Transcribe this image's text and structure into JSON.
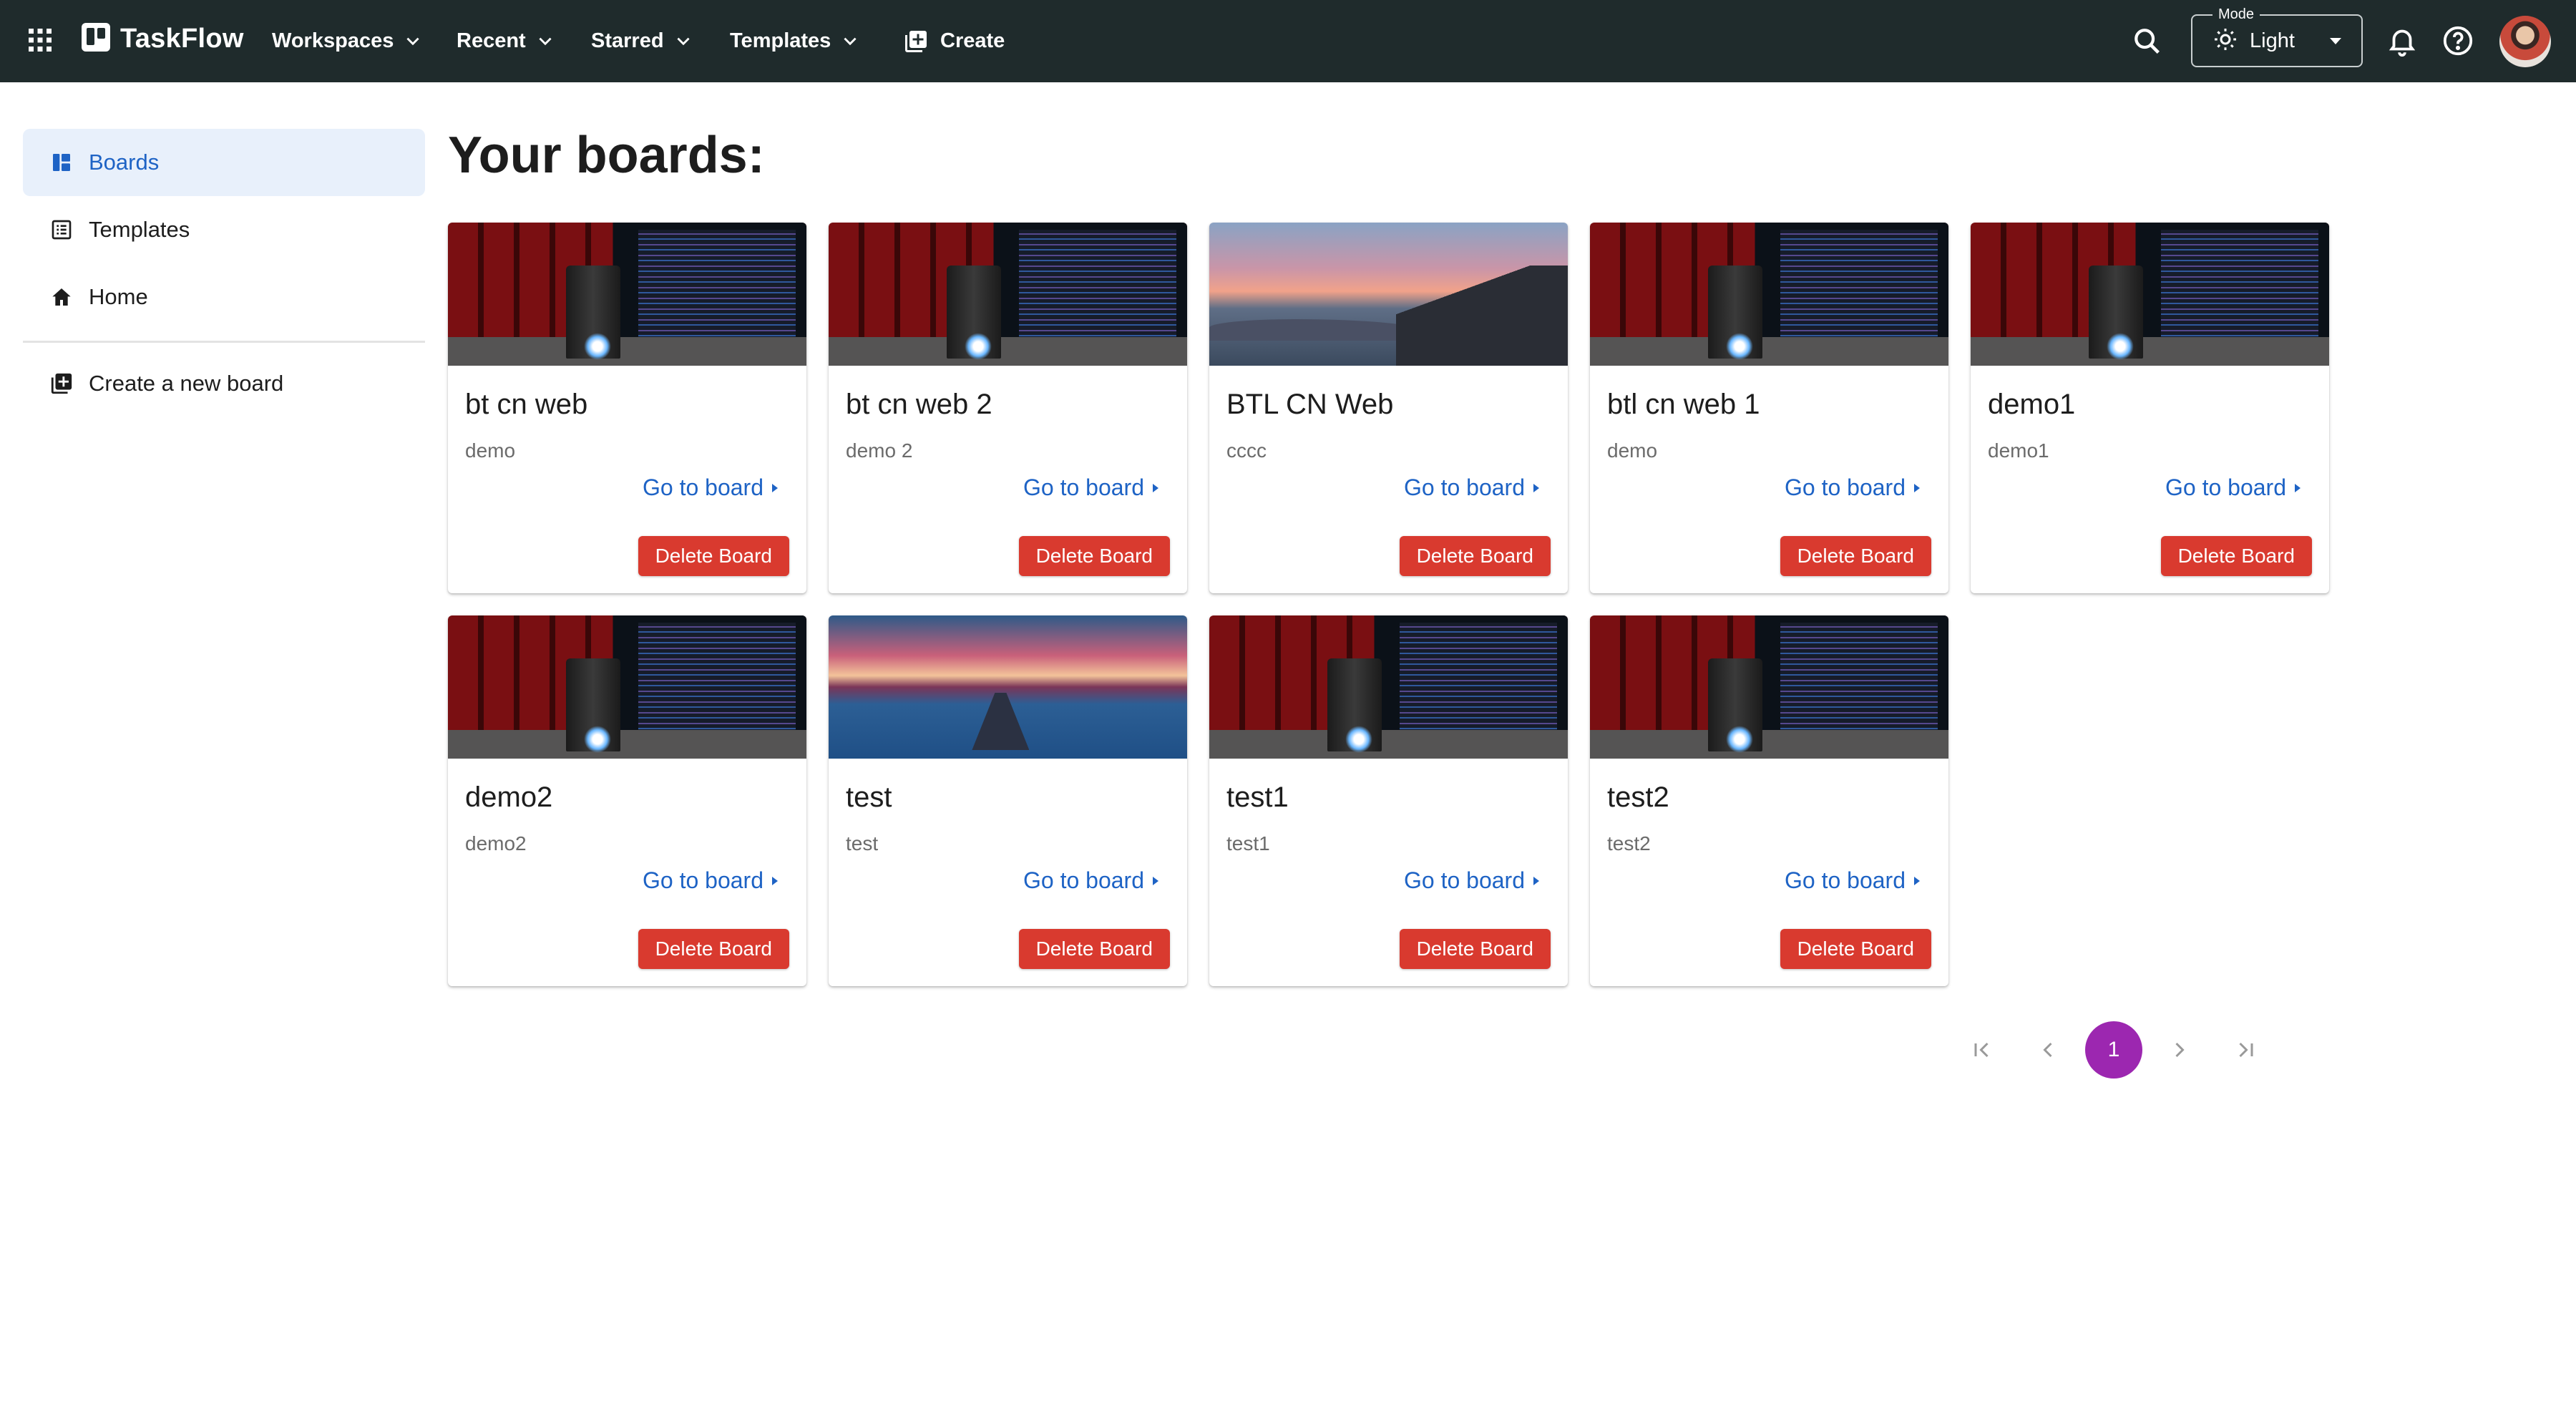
{
  "header": {
    "brand": "TaskFlow",
    "menus": [
      "Workspaces",
      "Recent",
      "Starred",
      "Templates"
    ],
    "create_label": "Create",
    "mode_label": "Mode",
    "mode_value": "Light"
  },
  "sidebar": {
    "items": [
      {
        "label": "Boards",
        "icon": "dashboard-icon",
        "active": true
      },
      {
        "label": "Templates",
        "icon": "list-icon",
        "active": false
      },
      {
        "label": "Home",
        "icon": "home-icon",
        "active": false
      }
    ],
    "create_board_label": "Create a new board"
  },
  "main": {
    "title": "Your boards:",
    "goto_label": "Go to board",
    "delete_label": "Delete Board",
    "boards": [
      {
        "title": "bt cn web",
        "description": "demo",
        "cover": "desk"
      },
      {
        "title": "bt cn web 2",
        "description": "demo 2",
        "cover": "desk"
      },
      {
        "title": "BTL CN Web",
        "description": "cccc",
        "cover": "sunset"
      },
      {
        "title": "btl cn web 1",
        "description": "demo",
        "cover": "desk"
      },
      {
        "title": "demo1",
        "description": "demo1",
        "cover": "desk"
      },
      {
        "title": "demo2",
        "description": "demo2",
        "cover": "desk"
      },
      {
        "title": "test",
        "description": "test",
        "cover": "lake"
      },
      {
        "title": "test1",
        "description": "test1",
        "cover": "desk"
      },
      {
        "title": "test2",
        "description": "test2",
        "cover": "desk"
      }
    ]
  },
  "pagination": {
    "current_page": "1"
  },
  "colors": {
    "topbar": "#1f2b2c",
    "accent": "#1e63c5",
    "delete": "#d93a2f",
    "page_active": "#9c27b0"
  }
}
